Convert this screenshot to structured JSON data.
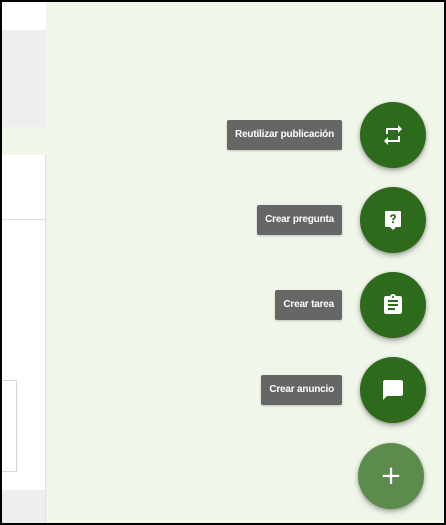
{
  "speed_dial": {
    "actions": [
      {
        "id": "reuse",
        "label": "Reutilizar publicación",
        "icon": "repeat-icon"
      },
      {
        "id": "question",
        "label": "Crear pregunta",
        "icon": "question-icon"
      },
      {
        "id": "assignment",
        "label": "Crear tarea",
        "icon": "assignment-icon"
      },
      {
        "id": "announcement",
        "label": "Crear anuncio",
        "icon": "chat-icon"
      }
    ],
    "main_button": {
      "glyph": "+",
      "icon": "plus-icon"
    }
  },
  "colors": {
    "background": "#f1f6ea",
    "fab_dark": "#2e6a1b",
    "fab_main": "#5c8c4c",
    "label_bg": "#666666",
    "label_text": "#ffffff"
  }
}
